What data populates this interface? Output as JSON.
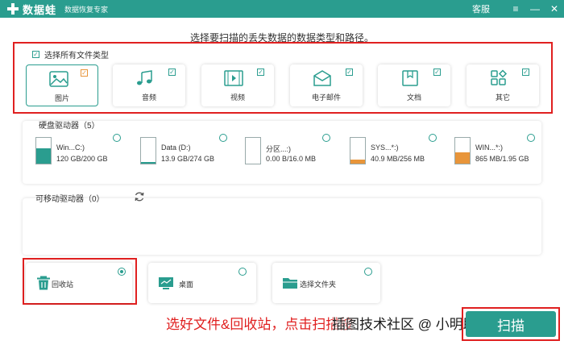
{
  "titlebar": {
    "app_name": "数据蛙",
    "subtitle": "数据恢复专家",
    "support_label": "客服",
    "menu_icon": "≡",
    "minimize_icon": "—",
    "close_icon": "✕"
  },
  "instruction": "选择要扫描的丢失数据的数据类型和路径。",
  "file_types": {
    "select_all_label": "选择所有文件类型",
    "items": [
      {
        "label": "图片",
        "icon": "image-icon",
        "checked": true
      },
      {
        "label": "音频",
        "icon": "audio-icon",
        "checked": true
      },
      {
        "label": "视频",
        "icon": "video-icon",
        "checked": true
      },
      {
        "label": "电子邮件",
        "icon": "email-icon",
        "checked": true
      },
      {
        "label": "文档",
        "icon": "document-icon",
        "checked": true
      },
      {
        "label": "其它",
        "icon": "other-icon",
        "checked": true
      }
    ]
  },
  "hard_drives": {
    "title": "硬盘驱动器（5）",
    "drives": [
      {
        "name": "Win...C:)",
        "size": "120 GB/200 GB",
        "used_fraction": 0.6,
        "fill_color": "#2a9d8f"
      },
      {
        "name": "Data (D:)",
        "size": "13.9 GB/274 GB",
        "used_fraction": 0.05,
        "fill_color": "#2a9d8f"
      },
      {
        "name": "分区...:)",
        "size": "0.00  B/16.0 MB",
        "used_fraction": 0.0,
        "fill_color": "#2a9d8f"
      },
      {
        "name": "SYS...*:)",
        "size": "40.9 MB/256 MB",
        "used_fraction": 0.16,
        "fill_color": "#e8953a"
      },
      {
        "name": "WIN...*:)",
        "size": "865 MB/1.95 GB",
        "used_fraction": 0.44,
        "fill_color": "#e8953a"
      }
    ]
  },
  "removable": {
    "title": "可移动驱动器（0）"
  },
  "locations": {
    "items": [
      {
        "label": "回收站",
        "icon": "trash-icon",
        "selected": true
      },
      {
        "label": "桌面",
        "icon": "desktop-icon",
        "selected": false
      },
      {
        "label": "选择文件夹",
        "icon": "folder-icon",
        "selected": false
      }
    ]
  },
  "annotation_text": "选好文件&回收站，点击扫描按",
  "watermark_text": "插图技术社区 @ 小明助手",
  "scan_button_label": "扫描"
}
